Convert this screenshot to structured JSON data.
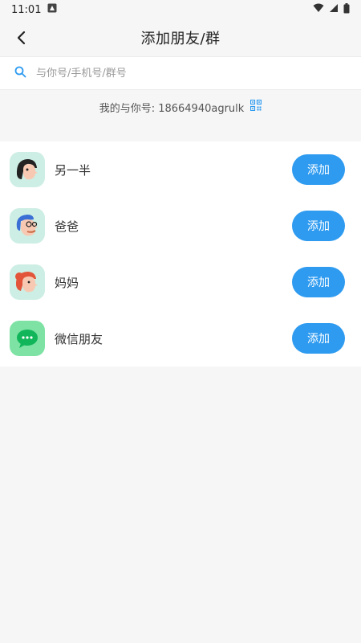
{
  "status_bar": {
    "time": "11:01"
  },
  "header": {
    "title": "添加朋友/群"
  },
  "search": {
    "placeholder": "与你号/手机号/群号"
  },
  "my_id": {
    "label": "我的与你号: 18664940agrulk"
  },
  "contacts": [
    {
      "label": "另一半",
      "button": "添加",
      "avatar": "woman-avatar-icon"
    },
    {
      "label": "爸爸",
      "button": "添加",
      "avatar": "dad-avatar-icon"
    },
    {
      "label": "妈妈",
      "button": "添加",
      "avatar": "mom-avatar-icon"
    },
    {
      "label": "微信朋友",
      "button": "添加",
      "avatar": "wechat-icon"
    }
  ],
  "colors": {
    "accent": "#2e9bf0",
    "avatar_bg": "#cdeee4",
    "wechat_bg": "#7de2a4"
  }
}
